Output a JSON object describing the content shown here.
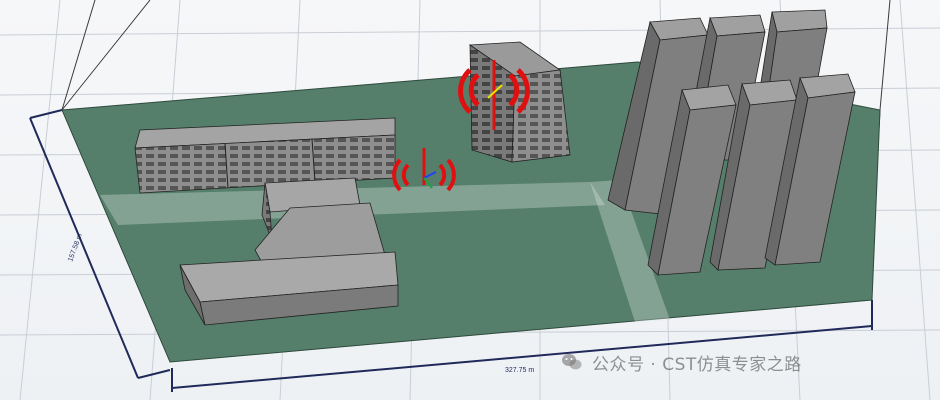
{
  "dimensions": {
    "length": "327.75 m",
    "width": "157.58 m"
  },
  "watermark": {
    "text": "公众号 · CST仿真专家之路",
    "icon": "wechat-icon"
  },
  "colors": {
    "ground": "#557f6b",
    "building_top": "#9b9b9b",
    "building_side": "#6f6f6f",
    "antenna_pattern": "#e01010",
    "dimension_line": "#1f2a5a",
    "bounding_box": "#333333"
  }
}
